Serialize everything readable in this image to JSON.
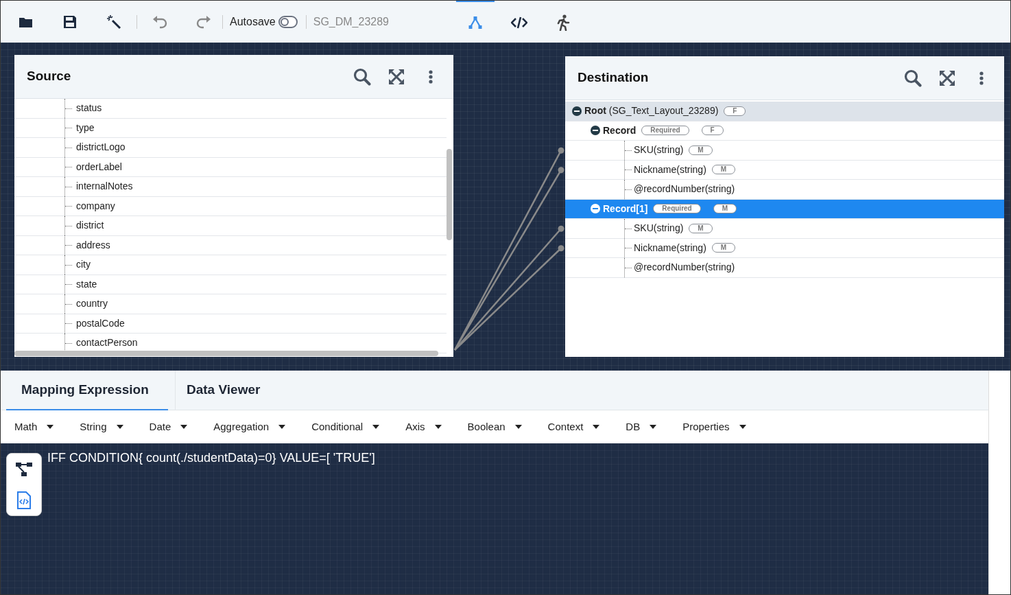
{
  "toolbar": {
    "autosave": {
      "label": "Autosave",
      "on": false
    },
    "document_name": "SG_DM_23289",
    "views": [
      {
        "kind": "mapping",
        "selected": true
      },
      {
        "kind": "code",
        "selected": false
      },
      {
        "kind": "run",
        "selected": false
      }
    ]
  },
  "source": {
    "title": "Source",
    "items": [
      "status",
      "type",
      "districtLogo",
      "orderLabel",
      "internalNotes",
      "company",
      "district",
      "address",
      "city",
      "state",
      "country",
      "postalCode",
      "contactPerson"
    ]
  },
  "destination": {
    "title": "Destination",
    "tree": [
      {
        "label": "Root",
        "detail": "(SG_Text_Layout_23289)",
        "badges": [
          "F"
        ],
        "expanded": true,
        "selected": false,
        "children": [
          {
            "label": "Record",
            "badges": [
              "Required",
              "F"
            ],
            "expanded": true,
            "selected": false,
            "children": [
              {
                "label": "SKU(string)",
                "badges": [
                  "M"
                ],
                "mapped": true
              },
              {
                "label": "Nickname(string)",
                "badges": [
                  "M"
                ],
                "mapped": true
              },
              {
                "label": "@recordNumber(string)",
                "mapped": false
              }
            ]
          },
          {
            "label": "Record[1]",
            "badges": [
              "Required",
              "M"
            ],
            "expanded": true,
            "selected": true,
            "children": [
              {
                "label": "SKU(string)",
                "badges": [
                  "M"
                ],
                "mapped": true
              },
              {
                "label": "Nickname(string)",
                "badges": [
                  "M"
                ],
                "mapped": true
              },
              {
                "label": "@recordNumber(string)",
                "mapped": false
              }
            ]
          }
        ]
      }
    ]
  },
  "bottom": {
    "tabs": [
      {
        "label": "Mapping Expression",
        "selected": true
      },
      {
        "label": "Data Viewer",
        "selected": false
      }
    ],
    "functions": [
      "Math",
      "String",
      "Date",
      "Aggregation",
      "Conditional",
      "Axis",
      "Boolean",
      "Context",
      "DB",
      "Properties"
    ],
    "expression": "IFF CONDITION{ count(./studentData)=0} VALUE=[ 'TRUE']"
  }
}
